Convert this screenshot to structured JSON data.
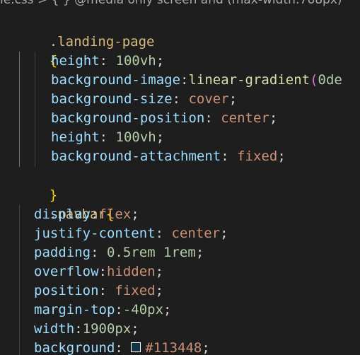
{
  "breadcrumb": {
    "file": "le.css",
    "separator": ">",
    "symbol": "{ }",
    "rule": "@media only screen and (max-width:768px)"
  },
  "code": {
    "landing_selector": ".landing-page",
    "open_brace": "{",
    "close_brace": "}",
    "landing_props": [
      {
        "prop": "height",
        "sep": ": ",
        "value": "100vh",
        "kind": "num",
        "end": ";"
      },
      {
        "prop": "background-image",
        "sep": ":",
        "func": "linear-gradient",
        "paren": "(",
        "rest": "0de",
        "end": ""
      },
      {
        "prop": "background-size",
        "sep": ": ",
        "value": "cover",
        "kind": "val",
        "end": ";"
      },
      {
        "prop": "background-position",
        "sep": ": ",
        "value": "center",
        "kind": "val",
        "end": ";"
      },
      {
        "prop": "height",
        "sep": ": ",
        "value": "100vh",
        "kind": "num",
        "end": ";"
      },
      {
        "prop": "background-attachment",
        "sep": ": ",
        "value": "fixed",
        "kind": "val",
        "end": ";"
      }
    ],
    "navbar_selector": ".navbar",
    "navbar_open": "{",
    "navbar_props": [
      {
        "prop": "display",
        "sep": ":",
        "value": "flex",
        "kind": "val",
        "end": ";"
      },
      {
        "prop": "justify-content",
        "sep": ": ",
        "value": "center",
        "kind": "val",
        "end": ";"
      },
      {
        "prop": "padding",
        "sep": ": ",
        "value": "0.5rem 1rem",
        "kind": "num",
        "end": ";"
      },
      {
        "prop": "overflow",
        "sep": ":",
        "value": "hidden",
        "kind": "val",
        "end": ";"
      },
      {
        "prop": "position",
        "sep": ": ",
        "value": "fixed",
        "kind": "val",
        "end": ";"
      },
      {
        "prop": "margin-top",
        "sep": ":",
        "value": "-40px",
        "kind": "num",
        "end": ";"
      },
      {
        "prop": "width",
        "sep": ":",
        "value": "1900px",
        "kind": "num",
        "end": ";"
      },
      {
        "prop": "background",
        "sep": ": ",
        "value": "#113448",
        "kind": "val",
        "end": ";",
        "swatch_color": "#113448"
      }
    ]
  },
  "colors": {
    "background": "#1e1e1e",
    "selector": "#d7ba7d",
    "brace": "#ffd700",
    "property": "#9cdcfe",
    "number": "#b5cea8",
    "string_value": "#ce9178",
    "function": "#dcdcaa",
    "paren": "#da70d6"
  }
}
